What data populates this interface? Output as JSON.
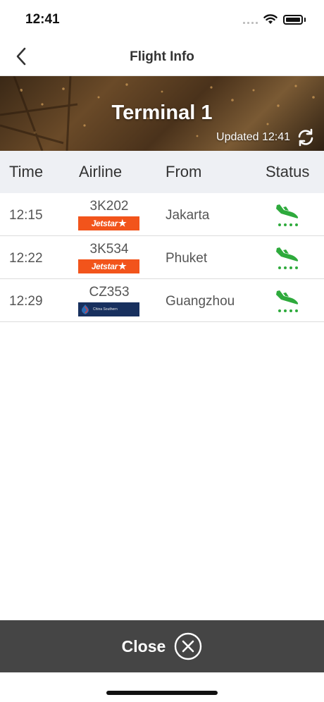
{
  "status_bar": {
    "time": "12:41",
    "icons": [
      "signal-icon",
      "wifi-icon",
      "battery-icon"
    ]
  },
  "nav": {
    "title": "Flight Info",
    "back_icon": "chevron-left-icon"
  },
  "banner": {
    "title": "Terminal 1",
    "updated": "Updated 12:41",
    "refresh_icon": "refresh-icon"
  },
  "table": {
    "headers": {
      "time": "Time",
      "airline": "Airline",
      "from": "From",
      "status": "Status"
    },
    "rows": [
      {
        "time": "12:15",
        "flight": "3K202",
        "airline_logo": "Jetstar",
        "from": "Jakarta",
        "status_icon": "plane-landed-icon"
      },
      {
        "time": "12:22",
        "flight": "3K534",
        "airline_logo": "Jetstar",
        "from": "Phuket",
        "status_icon": "plane-landed-icon"
      },
      {
        "time": "12:29",
        "flight": "CZ353",
        "airline_logo": "China Southern",
        "from": "Guangzhou",
        "status_icon": "plane-landed-icon"
      }
    ]
  },
  "close": {
    "label": "Close",
    "icon": "close-circle-icon"
  },
  "colors": {
    "status_green": "#2eaa3c",
    "jetstar_orange": "#f2541b",
    "china_southern_navy": "#18305e",
    "close_bar": "#454545",
    "header_bg": "#eef0f4"
  }
}
